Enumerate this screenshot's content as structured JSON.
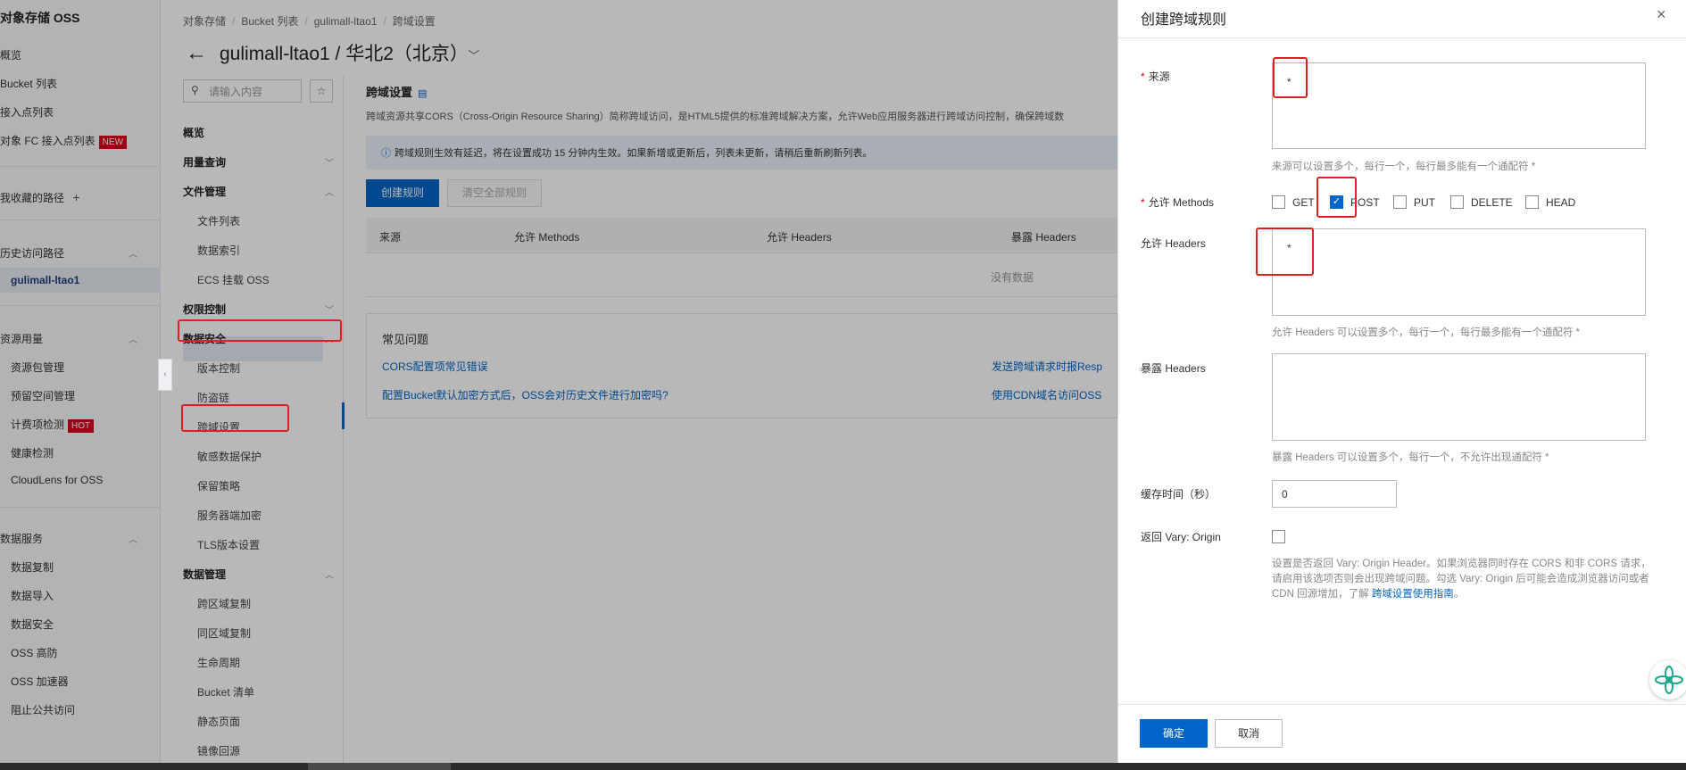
{
  "global_sidebar": {
    "brand": "对象存储 OSS",
    "items": [
      {
        "label": "概览"
      },
      {
        "label": "Bucket 列表"
      },
      {
        "label": "接入点列表"
      },
      {
        "label": "对象 FC 接入点列表",
        "badge": "NEW"
      }
    ],
    "favorites": {
      "label": "我收藏的路径",
      "plus": "+"
    },
    "history": {
      "label": "历史访问路径",
      "active": "gulimall-ltao1"
    },
    "resource": {
      "label": "资源用量",
      "items": [
        {
          "label": "资源包管理"
        },
        {
          "label": "预留空间管理"
        },
        {
          "label": "计费项检测",
          "badge": "HOT"
        },
        {
          "label": "健康检测"
        },
        {
          "label": "CloudLens for OSS"
        }
      ]
    },
    "data_service": {
      "label": "数据服务",
      "items": [
        {
          "label": "数据复制"
        },
        {
          "label": "数据导入"
        },
        {
          "label": "数据安全"
        },
        {
          "label": "OSS 高防"
        },
        {
          "label": "OSS 加速器"
        },
        {
          "label": "阻止公共访问"
        }
      ]
    }
  },
  "breadcrumb": [
    "对象存储",
    "Bucket 列表",
    "gulimall-ltao1",
    "跨域设置"
  ],
  "page_title": "gulimall-ltao1 / 华北2（北京）",
  "subnav": {
    "search_placeholder": "请输入内容",
    "items": [
      {
        "label": "概览"
      },
      {
        "label": "用量查询"
      },
      {
        "label": "文件管理"
      },
      {
        "label": "文件列表"
      },
      {
        "label": "数据索引"
      },
      {
        "label": "ECS 挂载 OSS"
      },
      {
        "label": "权限控制"
      },
      {
        "label": "数据安全"
      },
      {
        "label": "版本控制"
      },
      {
        "label": "防盗链"
      },
      {
        "label": "跨域设置"
      },
      {
        "label": "敏感数据保护"
      },
      {
        "label": "保留策略"
      },
      {
        "label": "服务器端加密"
      },
      {
        "label": "TLS版本设置"
      },
      {
        "label": "数据管理"
      },
      {
        "label": "跨区域复制"
      },
      {
        "label": "同区域复制"
      },
      {
        "label": "生命周期"
      },
      {
        "label": "Bucket 清单"
      },
      {
        "label": "静态页面"
      },
      {
        "label": "镜像回源"
      }
    ]
  },
  "cors": {
    "heading": "跨域设置",
    "description": "跨域资源共享CORS（Cross-Origin Resource Sharing）简称跨域访问，是HTML5提供的标准跨域解决方案，允许Web应用服务器进行跨域访问控制，确保跨域数",
    "notice": "跨域规则生效有延迟，将在设置成功 15 分钟内生效。如果新增或更新后，列表未更新，请稍后重新刷新列表。",
    "create_button": "创建规则",
    "clear_button": "清空全部规则",
    "columns": [
      "来源",
      "允许 Methods",
      "允许 Headers",
      "暴露 Headers"
    ],
    "empty": "没有数据"
  },
  "faq": {
    "title": "常见问题",
    "links": [
      "CORS配置项常见错误",
      "发送跨域请求时报Resp",
      "配置Bucket默认加密方式后，OSS会对历史文件进行加密吗?",
      "使用CDN域名访问OSS"
    ]
  },
  "drawer": {
    "title": "创建跨域规则",
    "close": "×",
    "origin": {
      "label": "来源",
      "value": "*",
      "hint": "来源可以设置多个，每行一个，每行最多能有一个通配符 *"
    },
    "methods": {
      "label": "允许 Methods",
      "options": [
        {
          "label": "GET",
          "checked": false
        },
        {
          "label": "POST",
          "checked": true
        },
        {
          "label": "PUT",
          "checked": false
        },
        {
          "label": "DELETE",
          "checked": false
        },
        {
          "label": "HEAD",
          "checked": false
        }
      ]
    },
    "allow_headers": {
      "label": "允许 Headers",
      "value": "*",
      "hint": "允许 Headers 可以设置多个，每行一个，每行最多能有一个通配符 *"
    },
    "expose_headers": {
      "label": "暴露 Headers",
      "value": "",
      "hint": "暴露 Headers 可以设置多个，每行一个，不允许出现通配符 *"
    },
    "cache": {
      "label": "缓存时间（秒）",
      "value": "0"
    },
    "vary": {
      "label": "返回 Vary: Origin",
      "checked": false,
      "hint": "设置是否返回 Vary: Origin Header。如果浏览器同时存在 CORS 和非 CORS 请求，请启用该选项否则会出现跨域问题。勾选 Vary: Origin 后可能会造成浏览器访问或者 CDN 回源增加，了解 ",
      "link": "跨域设置使用指南",
      "tail": "。"
    },
    "ok_button": "确定",
    "cancel_button": "取消"
  },
  "colors": {
    "accent": "#0064c8",
    "annotation": "#e02020",
    "required": "#d9001b"
  }
}
